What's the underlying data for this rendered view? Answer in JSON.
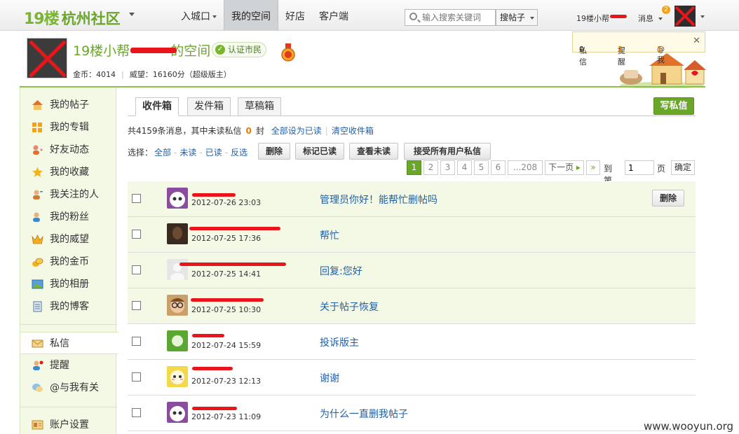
{
  "topbar": {
    "logo_num": "19楼",
    "logo_city": "杭州社区",
    "nav": [
      {
        "label": "入城口",
        "has_caret": true
      },
      {
        "label": "我的空间",
        "active": true
      },
      {
        "label": "好店"
      },
      {
        "label": "客户端"
      }
    ],
    "search_placeholder": "输入搜索关键词",
    "search_scope": "搜帖子",
    "user_name": "19楼小帮",
    "messages_label": "消息",
    "messages_badge": "2"
  },
  "notice": {
    "private_label": "私信",
    "private_count": "0",
    "remind_label": "提醒",
    "remind_count": "1",
    "at_label": "@我",
    "at_count": "1"
  },
  "profile": {
    "title_prefix": "19楼小帮",
    "title_suffix": "的空间",
    "verified_label": "认证市民",
    "coins": "金币：4014",
    "prestige": "威望：16160分（超级版主）"
  },
  "sidebar": {
    "items": [
      {
        "label": "我的帖子",
        "icon": "home-icon"
      },
      {
        "label": "我的专辑",
        "icon": "grid-icon"
      },
      {
        "label": "好友动态",
        "icon": "friends-icon"
      },
      {
        "label": "我的收藏",
        "icon": "star-icon"
      },
      {
        "label": "我关注的人",
        "icon": "follow-icon"
      },
      {
        "label": "我的粉丝",
        "icon": "fans-icon"
      },
      {
        "label": "我的威望",
        "icon": "crown-icon"
      },
      {
        "label": "我的金币",
        "icon": "coins-icon"
      },
      {
        "label": "我的相册",
        "icon": "album-icon"
      },
      {
        "label": "我的博客",
        "icon": "blog-icon"
      }
    ],
    "group2": [
      {
        "label": "私信",
        "icon": "mail-icon",
        "active": true
      },
      {
        "label": "提醒",
        "icon": "remind-icon"
      },
      {
        "label": "@与我有关",
        "icon": "at-icon"
      }
    ],
    "group3": [
      {
        "label": "账户设置",
        "icon": "settings-icon"
      }
    ]
  },
  "tabs": [
    "收件箱",
    "发件箱",
    "草稿箱"
  ],
  "compose_label": "写私信",
  "summary": {
    "total": "共4159条消息，其中未读私信",
    "unread": "0",
    "unit": "封",
    "mark_all": "全部设为已读",
    "clear": "清空收件箱"
  },
  "select": {
    "label": "选择：",
    "options": [
      "全部",
      "未读",
      "已读",
      "反选"
    ],
    "buttons": [
      "删除",
      "标记已读",
      "查看未读",
      "接受所有用户私信"
    ]
  },
  "pager": {
    "pages": [
      "1",
      "2",
      "3",
      "4",
      "5",
      "6",
      "...208"
    ],
    "current": "1",
    "next": "下一页",
    "goto_label": "到第",
    "goto_value": "1",
    "page_unit": "页",
    "confirm": "确定"
  },
  "messages": [
    {
      "time": "2012-07-26 23:03",
      "subject": "管理员你好！能帮忙删帖吗",
      "unread": true,
      "show_delete": true,
      "delete_label": "删除",
      "avatar_color": "#8b4ca0"
    },
    {
      "time": "2012-07-25 17:36",
      "subject": "帮忙",
      "unread": true,
      "avatar_color": "#3a2a20"
    },
    {
      "time": "2012-07-25 14:41",
      "subject": "回复:您好",
      "unread": true,
      "avatar_color": "#e6e6e6"
    },
    {
      "time": "2012-07-25 10:30",
      "subject": "关于帖子恢复",
      "unread": true,
      "avatar_color": "#c9a06a"
    },
    {
      "time": "2012-07-24 15:59",
      "subject": "投诉版主",
      "unread": false,
      "avatar_color": "#5aa832"
    },
    {
      "time": "2012-07-23 12:13",
      "subject": "谢谢",
      "unread": false,
      "avatar_color": "#f2d94a"
    },
    {
      "time": "2012-07-23 11:09",
      "subject": "为什么一直删我帖子",
      "unread": false,
      "avatar_color": "#8b4ca0"
    }
  ],
  "watermark": "www.wooyun.org"
}
